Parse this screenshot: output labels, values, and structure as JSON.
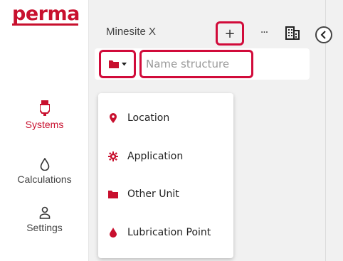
{
  "brand": {
    "logo_text": "perma",
    "color": "#c8102e"
  },
  "nav": {
    "items": [
      {
        "label": "Systems",
        "icon": "lubricator-icon",
        "active": true
      },
      {
        "label": "Calculations",
        "icon": "droplet-outline-icon",
        "active": false
      },
      {
        "label": "Settings",
        "icon": "user-icon",
        "active": false
      }
    ]
  },
  "header": {
    "title": "Minesite X",
    "add_label": "+",
    "more_label": "···",
    "building_icon": "building-icon",
    "collapse_icon": "chevron-left-icon"
  },
  "search": {
    "folder_icon": "folder-icon",
    "placeholder": "Name structure",
    "value": ""
  },
  "dropdown": {
    "items": [
      {
        "label": "Location",
        "icon": "map-pin-icon"
      },
      {
        "label": "Application",
        "icon": "gear-icon"
      },
      {
        "label": "Other Unit",
        "icon": "folder-icon"
      },
      {
        "label": "Lubrication Point",
        "icon": "drop-icon"
      }
    ]
  },
  "colors": {
    "accent": "#d10b3a",
    "background": "#f1f1f1",
    "text": "#444444"
  }
}
